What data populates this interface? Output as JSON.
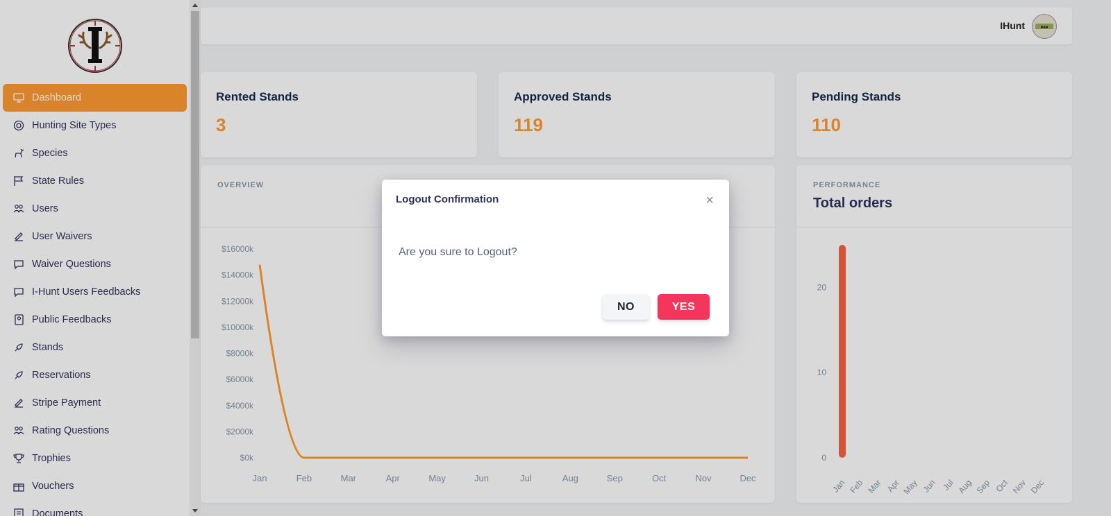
{
  "sidebar": {
    "items": [
      {
        "label": "Dashboard",
        "icon": "monitor-icon",
        "active": true
      },
      {
        "label": "Hunting Site Types",
        "icon": "lifebuoy-icon"
      },
      {
        "label": "Species",
        "icon": "deer-icon"
      },
      {
        "label": "State Rules",
        "icon": "flag-icon"
      },
      {
        "label": "Users",
        "icon": "users-icon"
      },
      {
        "label": "User Waivers",
        "icon": "signature-icon"
      },
      {
        "label": "Waiver Questions",
        "icon": "comment-icon"
      },
      {
        "label": "I-Hunt Users Feedbacks",
        "icon": "comment-icon"
      },
      {
        "label": "Public Feedbacks",
        "icon": "contact-book-icon"
      },
      {
        "label": "Stands",
        "icon": "rocket-icon"
      },
      {
        "label": "Reservations",
        "icon": "rocket-icon"
      },
      {
        "label": "Stripe Payment",
        "icon": "signature-icon"
      },
      {
        "label": "Rating Questions",
        "icon": "users-icon"
      },
      {
        "label": "Trophies",
        "icon": "trophy-icon"
      },
      {
        "label": "Vouchers",
        "icon": "gift-icon"
      },
      {
        "label": "Documents",
        "icon": "document-icon"
      }
    ]
  },
  "topbar": {
    "user_name": "IHunt"
  },
  "stats": [
    {
      "title": "Rented Stands",
      "value": "3"
    },
    {
      "title": "Approved Stands",
      "value": "119"
    },
    {
      "title": "Pending Stands",
      "value": "110"
    }
  ],
  "overview": {
    "label": "OVERVIEW"
  },
  "performance": {
    "label": "PERFORMANCE",
    "title": "Total orders"
  },
  "modal": {
    "title": "Logout Confirmation",
    "close": "×",
    "message": "Are you sure to Logout?",
    "no_label": "NO",
    "yes_label": "YES"
  },
  "colors": {
    "accent": "#ff9c33",
    "danger": "#f5365c",
    "bar": "#fb6340"
  },
  "chart_data": [
    {
      "type": "line",
      "categories": [
        "Jan",
        "Feb",
        "Mar",
        "Apr",
        "May",
        "Jun",
        "Jul",
        "Aug",
        "Sep",
        "Oct",
        "Nov",
        "Dec"
      ],
      "values": [
        14800,
        0,
        0,
        0,
        0,
        0,
        0,
        0,
        0,
        0,
        0,
        0
      ],
      "ytick_labels": [
        "$0k",
        "$2000k",
        "$4000k",
        "$6000k",
        "$8000k",
        "$10000k",
        "$12000k",
        "$14000k",
        "$16000k"
      ],
      "ylim": [
        0,
        16000
      ],
      "grid": false
    },
    {
      "type": "bar",
      "categories": [
        "Jan",
        "Feb",
        "Mar",
        "Apr",
        "May",
        "Jun",
        "Jul",
        "Aug",
        "Sep",
        "Oct",
        "Nov",
        "Dec"
      ],
      "values": [
        25,
        0,
        0,
        0,
        0,
        0,
        0,
        0,
        0,
        0,
        0,
        0
      ],
      "ytick_labels": [
        "0",
        "10",
        "20"
      ],
      "ylim": [
        0,
        25
      ],
      "grid": false
    }
  ]
}
